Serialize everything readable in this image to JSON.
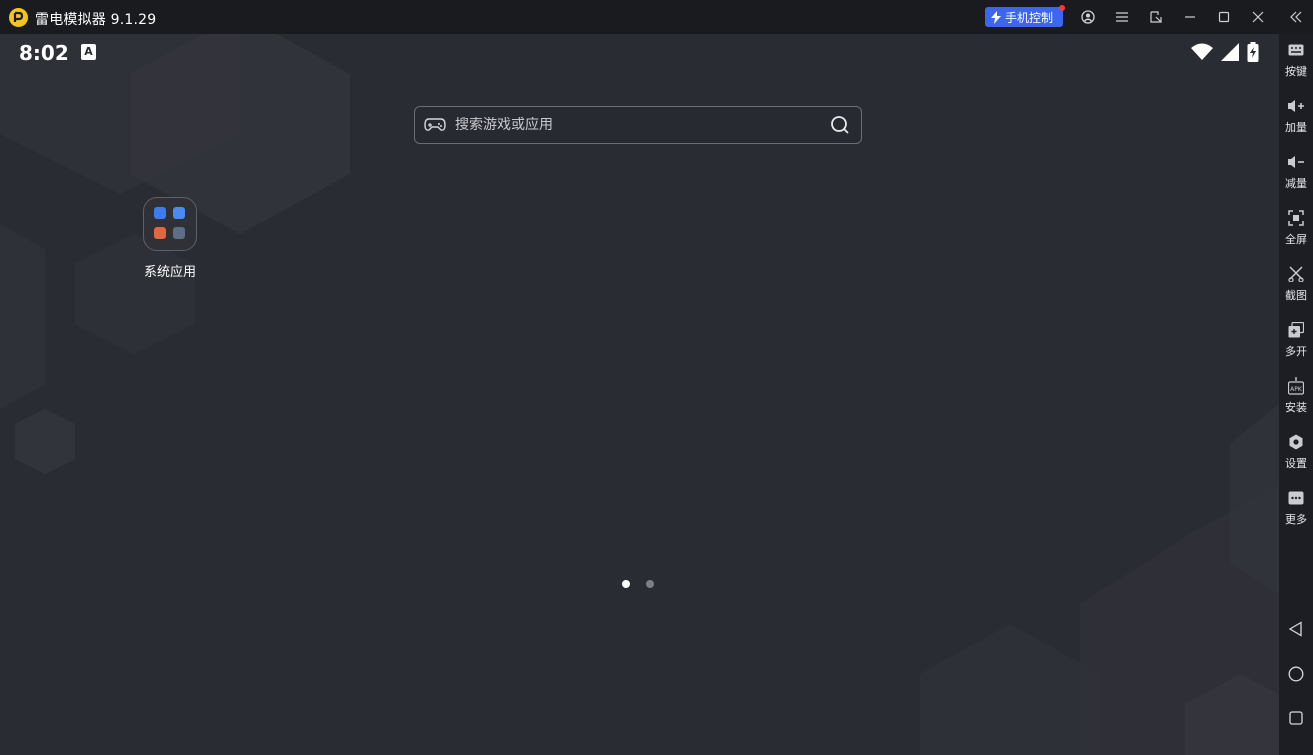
{
  "window": {
    "title": "雷电模拟器 9.1.29",
    "phone_control_label": "手机控制",
    "accent": "#3c66f0",
    "logo_color": "#f5c518",
    "buttons": [
      "account-icon",
      "menu-icon",
      "popout-icon",
      "minimize-icon",
      "maximize-icon",
      "close-icon",
      "collapse-sidebar-icon"
    ]
  },
  "status_bar": {
    "time": "8:02",
    "indicator": "A",
    "icons": [
      "wifi-icon",
      "signal-icon",
      "battery-charging-icon"
    ]
  },
  "search": {
    "placeholder": "搜索游戏或应用"
  },
  "desktop": {
    "folder": {
      "label": "系统应用",
      "apps": [
        "settings-app-icon",
        "browser-app-icon",
        "gallery-app-icon",
        "contacts-app-icon"
      ]
    },
    "pages": {
      "count": 2,
      "current": 1
    }
  },
  "sidebar": {
    "items": [
      {
        "label": "按键",
        "icon": "keyboard-icon"
      },
      {
        "label": "加量",
        "icon": "volume-up-icon"
      },
      {
        "label": "减量",
        "icon": "volume-down-icon"
      },
      {
        "label": "全屏",
        "icon": "fullscreen-icon"
      },
      {
        "label": "截图",
        "icon": "screenshot-icon"
      },
      {
        "label": "多开",
        "icon": "multi-instance-icon"
      },
      {
        "label": "安装",
        "icon": "install-apk-icon"
      },
      {
        "label": "设置",
        "icon": "settings-icon"
      },
      {
        "label": "更多",
        "icon": "more-icon"
      }
    ],
    "nav": [
      "back-icon",
      "home-icon",
      "recents-icon"
    ]
  }
}
